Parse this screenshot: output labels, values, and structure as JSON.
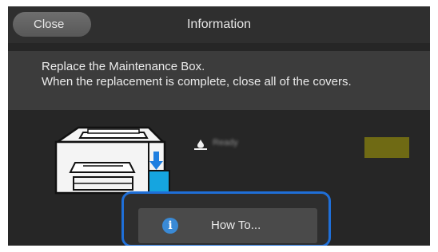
{
  "header": {
    "close_label": "Close",
    "title": "Information"
  },
  "message": {
    "line1": "Replace the Maintenance Box.",
    "line2": "When the replacement is complete, close all of the covers."
  },
  "illustration": {
    "icon": "printer-maintenance-box-icon",
    "arrow_icon": "arrow-down-icon",
    "arrow_color": "#1f7fe0",
    "box_color": "#15a5e0"
  },
  "status": {
    "icon": "ink-drop-icon",
    "text": "Ready",
    "swatch_color": "#6f6a14"
  },
  "howto": {
    "icon": "info-icon",
    "icon_glyph": "i",
    "label": "How To...",
    "highlight_color": "#1f6fd8"
  },
  "colors": {
    "screen_bg": "#262626",
    "panel_bg": "#3c3c3c",
    "button_bg": "#4a4a4a"
  }
}
